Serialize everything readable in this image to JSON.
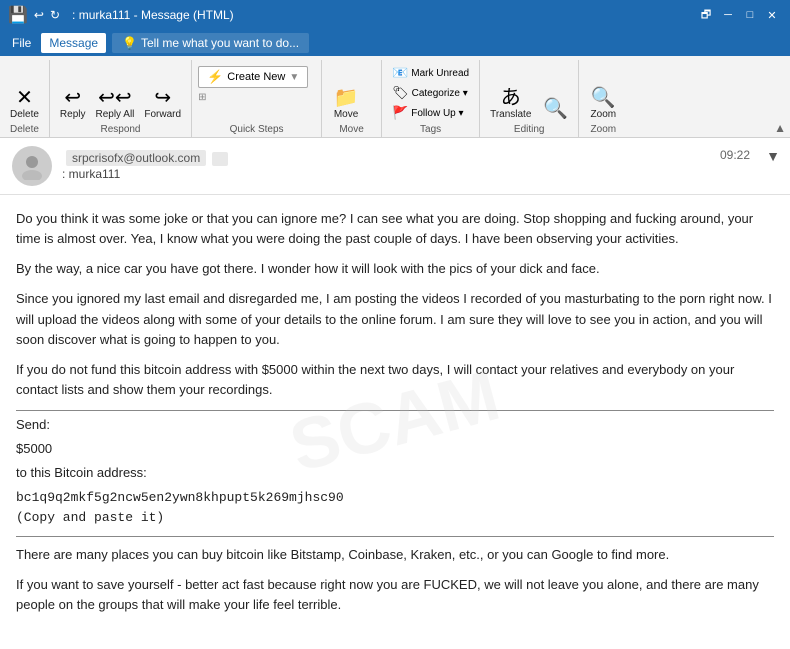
{
  "titlebar": {
    "icon": "💾",
    "title": ": murka111 - Message (HTML)",
    "controls": [
      "🗗",
      "─",
      "□",
      "✕"
    ]
  },
  "menubar": {
    "items": [
      "File",
      "Message"
    ],
    "active": "Message",
    "search_placeholder": "Tell me what you want to do..."
  },
  "ribbon": {
    "groups": [
      {
        "name": "Delete",
        "buttons": [
          {
            "icon": "✕",
            "label": "Delete"
          }
        ]
      },
      {
        "name": "Respond",
        "buttons": [
          {
            "icon": "↩",
            "label": "Reply"
          },
          {
            "icon": "↩↩",
            "label": "Reply All"
          },
          {
            "icon": "→",
            "label": "Forward"
          }
        ]
      },
      {
        "name": "Quick Steps",
        "main_btn": "Create New",
        "dropdown": "▼"
      },
      {
        "name": "Move",
        "buttons": [
          {
            "icon": "📁",
            "label": "Move"
          }
        ]
      },
      {
        "name": "Tags",
        "buttons": [
          {
            "icon": "📧",
            "label": "Mark Unread"
          },
          {
            "icon": "🏷",
            "label": "Categorize"
          },
          {
            "icon": "🚩",
            "label": "Follow Up"
          }
        ]
      },
      {
        "name": "Editing",
        "buttons": [
          {
            "icon": "あ",
            "label": "Translate"
          },
          {
            "icon": "🔍",
            "label": ""
          }
        ]
      },
      {
        "name": "Zoom",
        "buttons": [
          {
            "icon": "🔍",
            "label": "Zoom"
          }
        ]
      }
    ]
  },
  "email": {
    "from": "srpcrisofx@outlook.com",
    "from_tag": "",
    "subject": ": murka111",
    "time": "09:22",
    "body_paragraphs": [
      "Do you think it was some joke or that you can ignore me? I can see what you are doing. Stop shopping and fucking around, your time is almost over. Yea, I know what you were doing the past couple of days. I have been observing your activities.",
      "By the way, a nice car you have got there. I wonder how it will look with the pics of your dick and face.",
      "Since you ignored my last email and disregarded me, I am posting the videos I recorded of you masturbating to the porn right now. I will upload the videos along with some of your details to the online forum. I am sure they will love to see you in action, and you will soon discover what is going to happen to you.",
      "If you do not fund this bitcoin address with $5000 within the next two days, I will contact your relatives and everybody on your contact lists and show them your recordings."
    ],
    "divider": "══════════════════════════════════",
    "send_label": "Send:",
    "amount": "$5000",
    "btc_label": "to this Bitcoin address:",
    "btc_address": "bc1q9q2mkf5g2ncw5en2ywn8khpupt5k269mjhsc90",
    "copy_note": "(Copy and paste it)",
    "divider2": "══════════════════════════════════",
    "footer_paragraphs": [
      "There are many places you can buy bitcoin like Bitstamp, Coinbase, Kraken, etc., or you can Google to find more.",
      "If you want to save yourself - better act fast because right now you are FUCKED, we will not leave you alone, and there are many people on the groups that will make your life feel terrible."
    ]
  },
  "watermark_text": "SCAM"
}
